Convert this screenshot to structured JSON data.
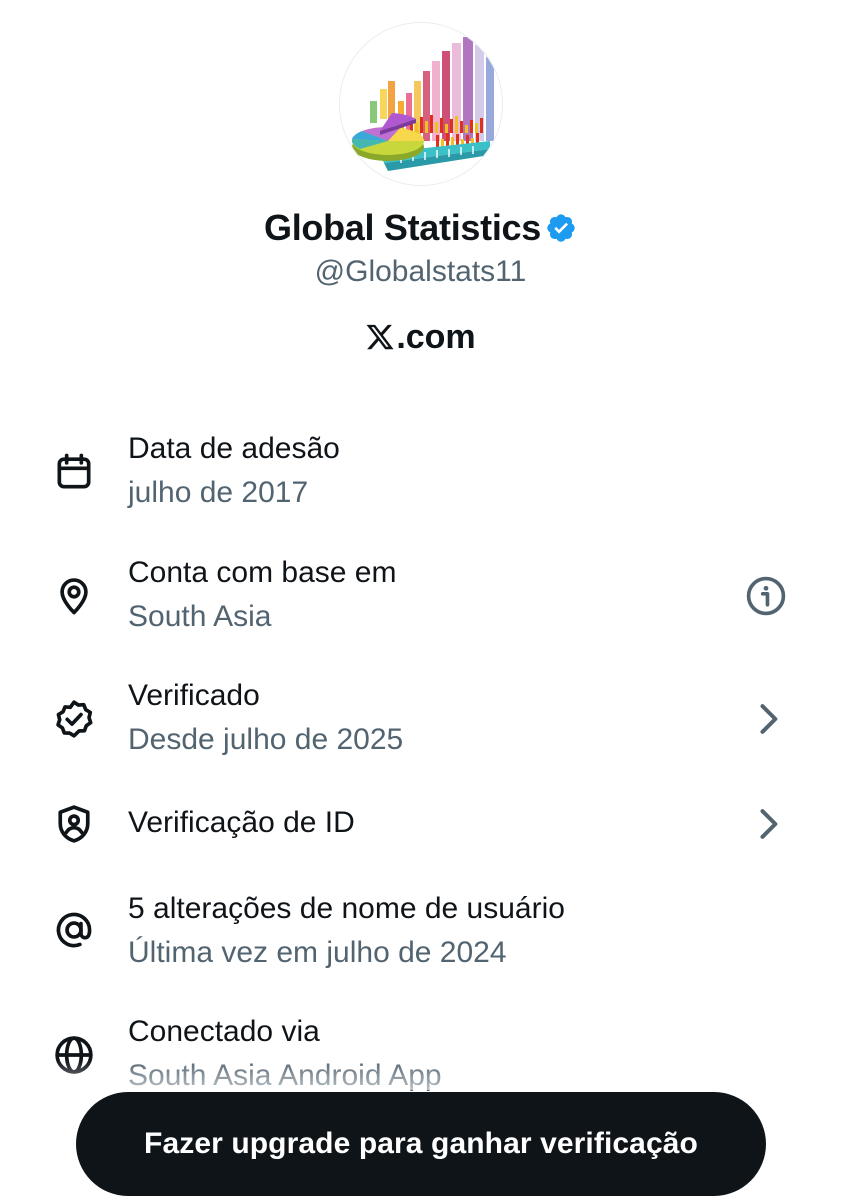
{
  "profile": {
    "display_name": "Global Statistics",
    "handle": "@Globalstats11",
    "verified_badge_icon": "verified-badge-icon",
    "badge_color": "#1d9bf0",
    "site_logo": "x-logo-icon",
    "site_text": ".com"
  },
  "details": [
    {
      "icon": "calendar-icon",
      "title": "Data de adesão",
      "subtitle": "julho de 2017",
      "trailing": ""
    },
    {
      "icon": "location-pin-icon",
      "title": "Conta com base em",
      "subtitle": "South Asia",
      "trailing": "info-icon"
    },
    {
      "icon": "verified-check-icon",
      "title": "Verificado",
      "subtitle": "Desde julho de 2025",
      "trailing": "chevron-right-icon"
    },
    {
      "icon": "id-shield-icon",
      "title": "Verificação de ID",
      "subtitle": "",
      "trailing": "chevron-right-icon"
    },
    {
      "icon": "at-sign-icon",
      "title": "5 alterações de nome de usuário",
      "subtitle": "Última vez em julho de 2024",
      "trailing": ""
    },
    {
      "icon": "globe-icon",
      "title": "Conectado via",
      "subtitle": "South Asia Android App",
      "trailing": ""
    }
  ],
  "cta": {
    "label": "Fazer upgrade para ganhar verificação",
    "background": "#0f1419",
    "text_color": "#ffffff"
  },
  "colors": {
    "primary_text": "#0f1419",
    "secondary_text": "#536471"
  }
}
